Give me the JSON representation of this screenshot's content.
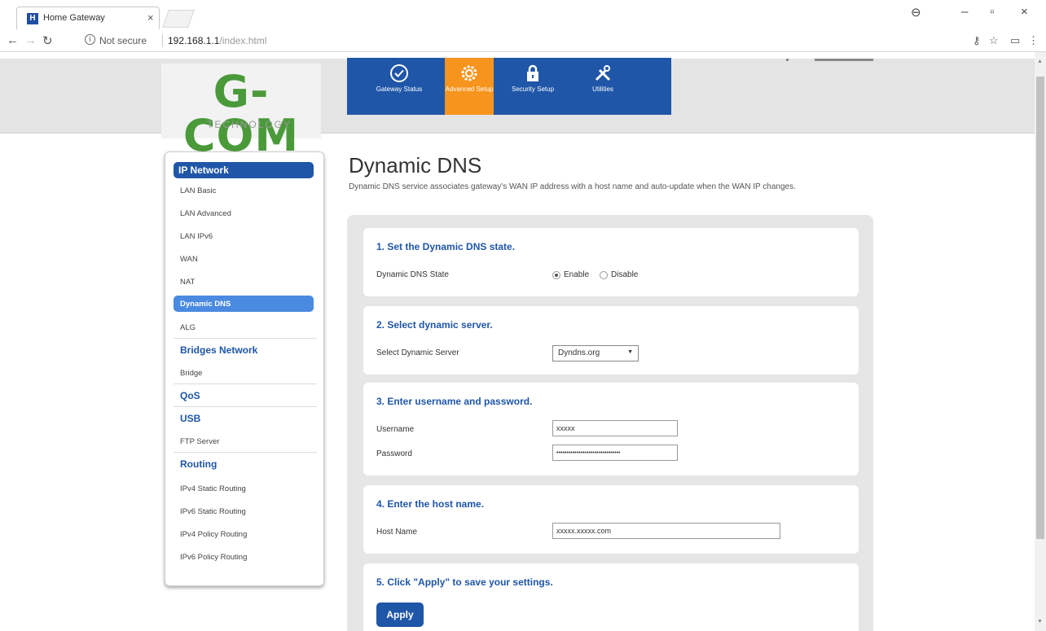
{
  "browser": {
    "tab_title": "Home Gateway",
    "tab_favicon_letter": "H",
    "secure_label": "Not secure",
    "url_host": "192.168.1.1",
    "url_path": "/index.html"
  },
  "brand": {
    "logo_main": "G-COM",
    "logo_sub": "TECHNOLOGY",
    "primary_color": "#1f56a8",
    "active_color": "#f7941d",
    "logo_color": "#4b9a3a"
  },
  "topnav": [
    {
      "label": "Gateway Status",
      "icon": "check-circle-icon"
    },
    {
      "label": "Advanced Setup",
      "icon": "gear-icon"
    },
    {
      "label": "Security Setup",
      "icon": "lock-icon"
    },
    {
      "label": "Utilities",
      "icon": "tools-icon"
    }
  ],
  "sidebar": {
    "ip_network": "IP Network",
    "ip_items": [
      "LAN Basic",
      "LAN Advanced",
      "LAN IPv6",
      "WAN",
      "NAT",
      "Dynamic DNS",
      "ALG"
    ],
    "bridges_network": "Bridges Network",
    "bridge_items": [
      "Bridge"
    ],
    "qos": "QoS",
    "usb": "USB",
    "usb_items": [
      "FTP Server"
    ],
    "routing": "Routing",
    "routing_items": [
      "IPv4 Static Routing",
      "IPv6 Static Routing",
      "IPv4 Policy Routing",
      "IPv6 Policy Routing"
    ]
  },
  "main": {
    "title": "Dynamic DNS",
    "description": "Dynamic DNS service associates gateway's WAN IP address with a host name and auto-update when the WAN IP changes.",
    "section1": {
      "title": "1. Set the Dynamic DNS state.",
      "label": "Dynamic DNS State",
      "enable": "Enable",
      "disable": "Disable"
    },
    "section2": {
      "title": "2. Select dynamic server.",
      "label": "Select Dynamic Server",
      "selected": "Dyndns.org"
    },
    "section3": {
      "title": "3. Enter username and password.",
      "username_label": "Username",
      "username_value": "xxxxx",
      "password_label": "Password",
      "password_value": "••••••••••••••••••••••••••••••••"
    },
    "section4": {
      "title": "4. Enter the host name.",
      "label": "Host Name",
      "value": "xxxxx.xxxxx.com"
    },
    "section5": {
      "title": "5. Click \"Apply\" to save your settings.",
      "apply": "Apply"
    }
  }
}
